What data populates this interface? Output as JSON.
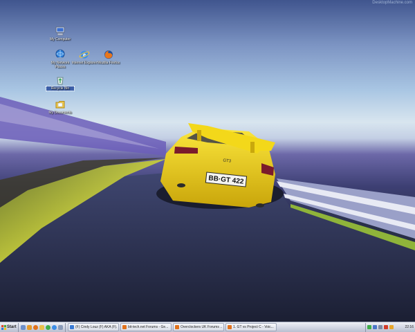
{
  "wallpaper": {
    "watermark": "DesktopMachine.com",
    "plate": "BB·GT 422",
    "badge": "GT3"
  },
  "desktop_icons": [
    {
      "label": "My Computer",
      "icon": "my-computer-icon"
    },
    {
      "label": "My Network Places",
      "icon": "network-places-icon"
    },
    {
      "label": "Internet Explorer",
      "icon": "internet-explorer-icon"
    },
    {
      "label": "Mozilla Firefox",
      "icon": "firefox-icon"
    },
    {
      "label": "Recycle Bin",
      "icon": "recycle-bin-icon"
    },
    {
      "label": "My Documents",
      "icon": "my-documents-icon"
    }
  ],
  "taskbar": {
    "start_label": "Start",
    "quick_launch": [
      "show-desktop-icon",
      "media-player-icon",
      "firefox-icon",
      "folder-icon",
      "messenger-icon",
      "ie-icon",
      "search-icon"
    ],
    "tasks": [
      {
        "label": "(F) Cindy Louz (F) AKA (F)...",
        "icon": "messenger-icon",
        "color": "#3a7bd5"
      },
      {
        "label": "bit-tech.net Forums - Ge...",
        "icon": "firefox-icon",
        "color": "#e2731d"
      },
      {
        "label": "Overclockers UK Forums ...",
        "icon": "firefox-icon",
        "color": "#e2731d"
      },
      {
        "label": "1. GT vs Project C - Voic...",
        "icon": "firefox-icon",
        "color": "#e2731d"
      }
    ],
    "clock": "22:16"
  },
  "colors": {
    "accent": "#3d5fa8",
    "car": "#f2d20c"
  }
}
